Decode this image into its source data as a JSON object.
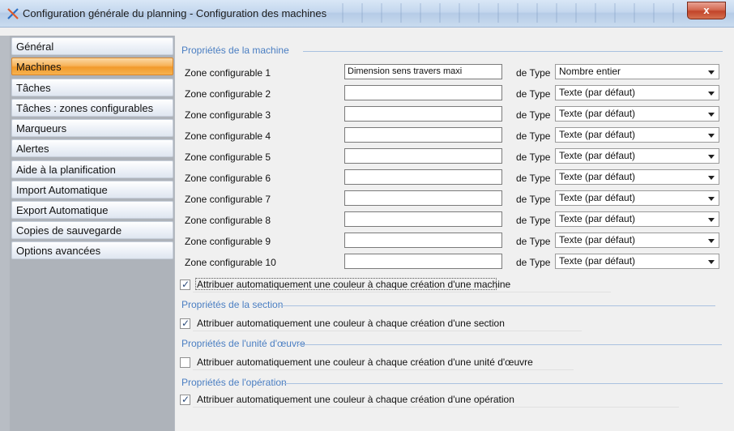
{
  "window": {
    "title": "Configuration générale du planning - Configuration des machines",
    "close_label": "x"
  },
  "sidebar": {
    "items": [
      {
        "label": "Général",
        "active": false
      },
      {
        "label": "Machines",
        "active": true
      },
      {
        "label": "Tâches",
        "active": false
      },
      {
        "label": "Tâches : zones configurables",
        "active": false
      },
      {
        "label": "Marqueurs",
        "active": false
      },
      {
        "label": "Alertes",
        "active": false
      },
      {
        "label": "Aide à la planification",
        "active": false
      },
      {
        "label": "Import Automatique",
        "active": false
      },
      {
        "label": "Export Automatique",
        "active": false
      },
      {
        "label": "Copies de sauvegarde",
        "active": false
      },
      {
        "label": "Options avancées",
        "active": false
      }
    ]
  },
  "machine_section": {
    "title": "Propriétés de la machine",
    "type_label": "de Type",
    "rows": [
      {
        "label": "Zone configurable 1",
        "value": "Dimension sens travers maxi",
        "type": "Nombre entier"
      },
      {
        "label": "Zone configurable 2",
        "value": "",
        "type": "Texte (par défaut)"
      },
      {
        "label": "Zone configurable 3",
        "value": "",
        "type": "Texte (par défaut)"
      },
      {
        "label": "Zone configurable 4",
        "value": "",
        "type": "Texte (par défaut)"
      },
      {
        "label": "Zone configurable 5",
        "value": "",
        "type": "Texte (par défaut)"
      },
      {
        "label": "Zone configurable 6",
        "value": "",
        "type": "Texte (par défaut)"
      },
      {
        "label": "Zone configurable 7",
        "value": "",
        "type": "Texte (par défaut)"
      },
      {
        "label": "Zone configurable 8",
        "value": "",
        "type": "Texte (par défaut)"
      },
      {
        "label": "Zone configurable 9",
        "value": "",
        "type": "Texte (par défaut)"
      },
      {
        "label": "Zone configurable 10",
        "value": "",
        "type": "Texte (par défaut)"
      }
    ],
    "auto_color_label": "Attribuer automatiquement une couleur à chaque création d'une machine",
    "auto_color_checked": true
  },
  "section_section": {
    "title": "Propriétés de la section",
    "auto_color_label": "Attribuer automatiquement une couleur à chaque création d'une section",
    "auto_color_checked": true
  },
  "work_unit_section": {
    "title": "Propriétés de l'unité d'œuvre",
    "auto_color_label": "Attribuer automatiquement une couleur à chaque création d'une unité d'œuvre",
    "auto_color_checked": false
  },
  "operation_section": {
    "title": "Propriétés de l'opération",
    "auto_color_label": "Attribuer automatiquement une couleur à chaque création d'une opération",
    "auto_color_checked": true
  },
  "colors": {
    "accent": "#4a7ec2",
    "active_tab": "#f19a2b",
    "sidebar_bg": "#aeb3ba"
  }
}
